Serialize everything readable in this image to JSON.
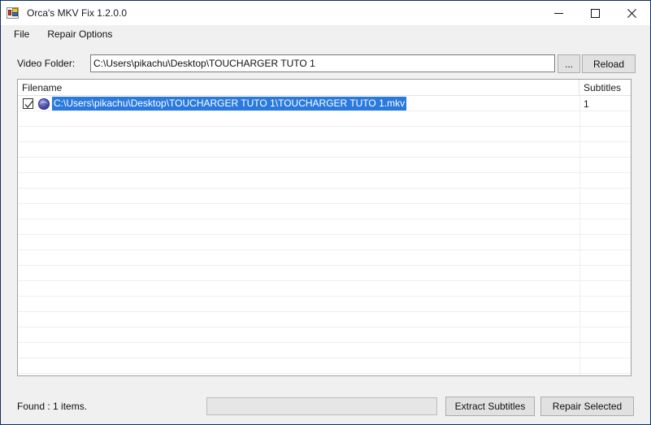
{
  "window": {
    "title": "Orca's MKV Fix 1.2.0.0",
    "icon": "app-window-icon",
    "controls": {
      "minimize": "minimize-icon",
      "maximize": "maximize-icon",
      "close": "close-icon"
    },
    "accent_selection_color": "#2a7ade",
    "titlebar_color": "#ffffff",
    "chrome_color": "#f0f0f0",
    "border_color": "#12305b"
  },
  "menu": {
    "items": [
      {
        "label": "File"
      },
      {
        "label": "Repair Options"
      }
    ]
  },
  "folder_row": {
    "label": "Video Folder:",
    "path_value": "C:\\Users\\pikachu\\Desktop\\TOUCHARGER TUTO 1",
    "path_placeholder": "",
    "browse_label": "...",
    "reload_label": "Reload"
  },
  "file_list": {
    "columns": [
      {
        "key": "filename",
        "label": "Filename"
      },
      {
        "key": "subtitles",
        "label": "Subtitles"
      }
    ],
    "rows": [
      {
        "checked": true,
        "icon": "mkv-file-icon",
        "filename": "C:\\Users\\pikachu\\Desktop\\TOUCHARGER TUTO 1\\TOUCHARGER TUTO 1.mkv",
        "subtitles": "1",
        "selected": true
      }
    ]
  },
  "bottom_bar": {
    "status": "Found : 1 items.",
    "progress_percent": 0,
    "extract_label": "Extract Subtitles",
    "repair_label": "Repair Selected"
  }
}
